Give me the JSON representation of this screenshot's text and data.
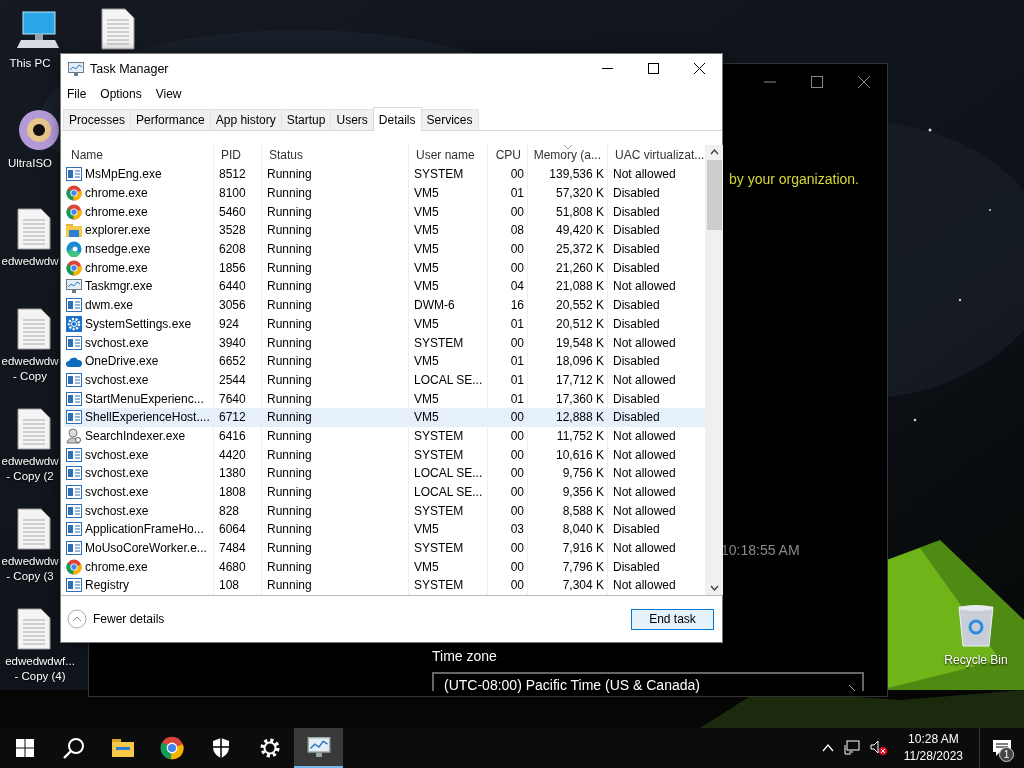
{
  "desktop": {
    "columns": [
      [
        {
          "kind": "pc",
          "lines": [
            "This PC"
          ]
        },
        {
          "kind": "disc",
          "lines": [
            "UltraISO"
          ]
        },
        {
          "kind": "document",
          "lines": [
            "edwedwdw"
          ]
        },
        {
          "kind": "document",
          "lines": [
            "edwedwdw",
            "- Copy"
          ]
        },
        {
          "kind": "document",
          "lines": [
            "edwedwdw",
            "- Copy (2"
          ]
        },
        {
          "kind": "document",
          "lines": [
            "edwedwdw",
            "- Copy (3"
          ]
        },
        {
          "kind": "document",
          "lines": [
            "edwedwdwf...",
            "- Copy (4)"
          ]
        }
      ],
      [
        {
          "kind": "document"
        }
      ]
    ],
    "recycle_bin": {
      "label": "Recycle Bin"
    }
  },
  "background_window": {
    "message": "by your organization.",
    "timestamp": "10:18:55 AM",
    "time_zone": {
      "label": "Time zone",
      "value": "(UTC-08:00) Pacific Time (US & Canada)"
    }
  },
  "task_manager": {
    "title": "Task Manager",
    "menu": [
      "File",
      "Options",
      "View"
    ],
    "tabs": [
      {
        "label": "Processes",
        "selected": false
      },
      {
        "label": "Performance",
        "selected": false
      },
      {
        "label": "App history",
        "selected": false
      },
      {
        "label": "Startup",
        "selected": false
      },
      {
        "label": "Users",
        "selected": false
      },
      {
        "label": "Details",
        "selected": true
      },
      {
        "label": "Services",
        "selected": false
      }
    ],
    "columns": [
      {
        "label": "Name",
        "sorted": false
      },
      {
        "label": "PID",
        "sorted": false
      },
      {
        "label": "Status",
        "sorted": false
      },
      {
        "label": "User name",
        "sorted": false
      },
      {
        "label": "CPU",
        "sorted": false
      },
      {
        "label": "Memory (a...",
        "sorted": true
      },
      {
        "label": "UAC virtualizat...",
        "sorted": false
      }
    ],
    "rows": [
      {
        "kind": "service",
        "cells": [
          "MsMpEng.exe",
          "8512",
          "Running",
          "SYSTEM",
          "00",
          "139,536 K",
          "Not allowed"
        ],
        "selected": false
      },
      {
        "kind": "chrome",
        "cells": [
          "chrome.exe",
          "8100",
          "Running",
          "VM5",
          "01",
          "57,320 K",
          "Disabled"
        ],
        "selected": false
      },
      {
        "kind": "chrome",
        "cells": [
          "chrome.exe",
          "5460",
          "Running",
          "VM5",
          "00",
          "51,808 K",
          "Disabled"
        ],
        "selected": false
      },
      {
        "kind": "explorer",
        "cells": [
          "explorer.exe",
          "3528",
          "Running",
          "VM5",
          "08",
          "49,420 K",
          "Disabled"
        ],
        "selected": false
      },
      {
        "kind": "edge",
        "cells": [
          "msedge.exe",
          "6208",
          "Running",
          "VM5",
          "00",
          "25,372 K",
          "Disabled"
        ],
        "selected": false
      },
      {
        "kind": "chrome",
        "cells": [
          "chrome.exe",
          "1856",
          "Running",
          "VM5",
          "00",
          "21,260 K",
          "Disabled"
        ],
        "selected": false
      },
      {
        "kind": "taskmgr",
        "cells": [
          "Taskmgr.exe",
          "6440",
          "Running",
          "VM5",
          "04",
          "21,088 K",
          "Not allowed"
        ],
        "selected": false
      },
      {
        "kind": "service",
        "cells": [
          "dwm.exe",
          "3056",
          "Running",
          "DWM-6",
          "16",
          "20,552 K",
          "Disabled"
        ],
        "selected": false
      },
      {
        "kind": "settings",
        "cells": [
          "SystemSettings.exe",
          "924",
          "Running",
          "VM5",
          "01",
          "20,512 K",
          "Disabled"
        ],
        "selected": false
      },
      {
        "kind": "service",
        "cells": [
          "svchost.exe",
          "3940",
          "Running",
          "SYSTEM",
          "00",
          "19,548 K",
          "Not allowed"
        ],
        "selected": false
      },
      {
        "kind": "onedrive",
        "cells": [
          "OneDrive.exe",
          "6652",
          "Running",
          "VM5",
          "01",
          "18,096 K",
          "Disabled"
        ],
        "selected": false
      },
      {
        "kind": "service",
        "cells": [
          "svchost.exe",
          "2544",
          "Running",
          "LOCAL SE...",
          "01",
          "17,712 K",
          "Not allowed"
        ],
        "selected": false
      },
      {
        "kind": "service",
        "cells": [
          "StartMenuExperienc...",
          "7640",
          "Running",
          "VM5",
          "01",
          "17,360 K",
          "Disabled"
        ],
        "selected": false
      },
      {
        "kind": "service",
        "cells": [
          "ShellExperienceHost....",
          "6712",
          "Running",
          "VM5",
          "00",
          "12,888 K",
          "Disabled"
        ],
        "selected": true
      },
      {
        "kind": "indexer",
        "cells": [
          "SearchIndexer.exe",
          "6416",
          "Running",
          "SYSTEM",
          "00",
          "11,752 K",
          "Not allowed"
        ],
        "selected": false
      },
      {
        "kind": "service",
        "cells": [
          "svchost.exe",
          "4420",
          "Running",
          "SYSTEM",
          "00",
          "10,616 K",
          "Not allowed"
        ],
        "selected": false
      },
      {
        "kind": "service",
        "cells": [
          "svchost.exe",
          "1380",
          "Running",
          "LOCAL SE...",
          "00",
          "9,756 K",
          "Not allowed"
        ],
        "selected": false
      },
      {
        "kind": "service",
        "cells": [
          "svchost.exe",
          "1808",
          "Running",
          "LOCAL SE...",
          "00",
          "9,356 K",
          "Not allowed"
        ],
        "selected": false
      },
      {
        "kind": "service",
        "cells": [
          "svchost.exe",
          "828",
          "Running",
          "SYSTEM",
          "00",
          "8,588 K",
          "Not allowed"
        ],
        "selected": false
      },
      {
        "kind": "service",
        "cells": [
          "ApplicationFrameHo...",
          "6064",
          "Running",
          "VM5",
          "03",
          "8,040 K",
          "Disabled"
        ],
        "selected": false
      },
      {
        "kind": "service",
        "cells": [
          "MoUsoCoreWorker.e...",
          "7484",
          "Running",
          "SYSTEM",
          "00",
          "7,916 K",
          "Not allowed"
        ],
        "selected": false
      },
      {
        "kind": "chrome",
        "cells": [
          "chrome.exe",
          "4680",
          "Running",
          "VM5",
          "00",
          "7,796 K",
          "Disabled"
        ],
        "selected": false
      },
      {
        "kind": "service",
        "cells": [
          "Registry",
          "108",
          "Running",
          "SYSTEM",
          "00",
          "7,304 K",
          "Not allowed"
        ],
        "selected": false
      }
    ],
    "footer": {
      "toggle": "Fewer details",
      "button": "End task"
    }
  },
  "taskbar": {
    "apps": [
      {
        "kind": "start",
        "active": false
      },
      {
        "kind": "search",
        "active": false
      },
      {
        "kind": "explorer",
        "active": false
      },
      {
        "kind": "chrome",
        "active": false
      },
      {
        "kind": "security",
        "active": false
      },
      {
        "kind": "settings",
        "active": false
      },
      {
        "kind": "taskmgr",
        "active": true
      }
    ],
    "time": "10:28 AM",
    "date": "11/28/2023",
    "notification_count": "1"
  }
}
